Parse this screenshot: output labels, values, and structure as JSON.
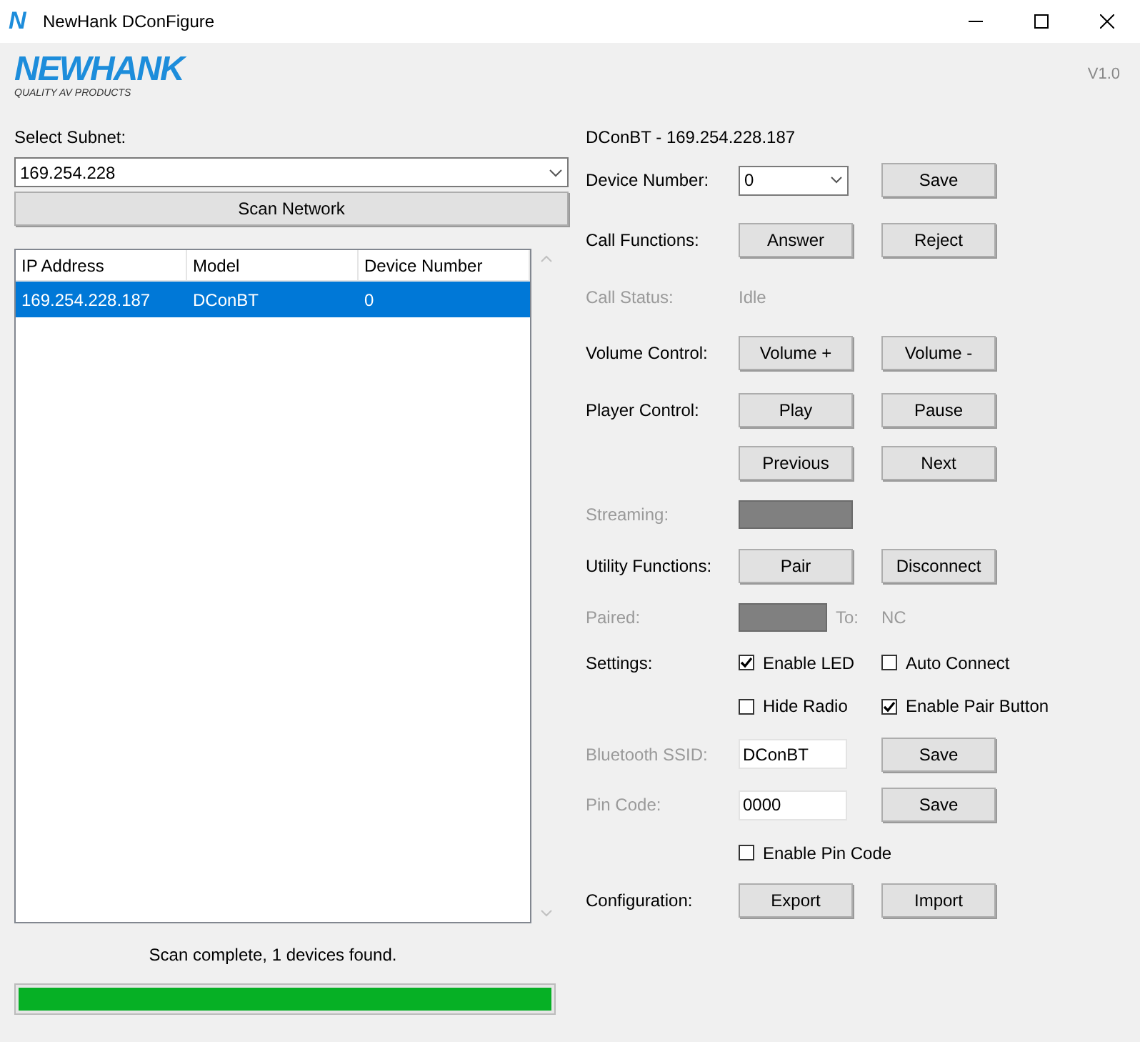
{
  "window": {
    "title": "NewHank DConFigure",
    "app_letter": "N"
  },
  "logo": {
    "name": "NEWHANK",
    "tagline": "QUALITY AV PRODUCTS"
  },
  "version": "V1.0",
  "subnet": {
    "label": "Select Subnet:",
    "value": "169.254.228"
  },
  "scan_button": "Scan Network",
  "table": {
    "columns": [
      "IP Address",
      "Model",
      "Device Number"
    ],
    "rows": [
      {
        "cells": [
          "169.254.228.187",
          "DConBT",
          "0"
        ],
        "selected": true
      }
    ]
  },
  "status_text": "Scan complete, 1 devices found.",
  "progress": {
    "level": 1
  },
  "device_panel": {
    "title": "DConBT - 169.254.228.187",
    "rows": [
      {
        "label": "Device Number:",
        "disabled": false,
        "primary": [
          {
            "kind": "select",
            "value": "0"
          }
        ],
        "secondary": [
          {
            "kind": "button",
            "label": "Save"
          }
        ]
      },
      {
        "label": "Call Functions:",
        "disabled": false,
        "primary": [
          {
            "kind": "button",
            "label": "Answer"
          }
        ],
        "secondary": [
          {
            "kind": "button",
            "label": "Reject"
          }
        ]
      },
      {
        "label": "Call Status:",
        "disabled": true,
        "primary": [
          {
            "kind": "text",
            "text": "Idle"
          }
        ],
        "secondary": []
      },
      {
        "label": "Volume Control:",
        "disabled": false,
        "primary": [
          {
            "kind": "button",
            "label": "Volume +"
          }
        ],
        "secondary": [
          {
            "kind": "button",
            "label": "Volume -"
          }
        ]
      },
      {
        "label": "Player Control:",
        "disabled": false,
        "primary": [
          {
            "kind": "button",
            "label": "Play"
          }
        ],
        "secondary": [
          {
            "kind": "button",
            "label": "Pause"
          }
        ]
      },
      {
        "primary": [
          {
            "kind": "button",
            "label": "Previous"
          }
        ],
        "secondary": [
          {
            "kind": "button",
            "label": "Next"
          }
        ]
      },
      {
        "label": "Streaming:",
        "disabled": true,
        "primary": [
          {
            "kind": "indicator",
            "on": false
          }
        ],
        "secondary": []
      },
      {
        "label": "Utility Functions:",
        "disabled": false,
        "primary": [
          {
            "kind": "button",
            "label": "Pair"
          }
        ],
        "secondary": [
          {
            "kind": "button",
            "label": "Disconnect"
          }
        ]
      },
      {
        "label": "Paired:",
        "disabled": true,
        "primary": [
          {
            "kind": "indicator",
            "on": false
          },
          {
            "kind": "text",
            "text": "To:"
          }
        ],
        "secondary": [
          {
            "kind": "text",
            "text": "NC"
          }
        ]
      },
      {
        "label": "Settings:",
        "disabled": false,
        "primary": [
          {
            "kind": "checkbox",
            "label": "Enable LED",
            "checked": true
          }
        ],
        "secondary": [
          {
            "kind": "checkbox",
            "label": "Auto Connect",
            "checked": false
          }
        ]
      },
      {
        "primary": [
          {
            "kind": "checkbox",
            "label": "Hide Radio",
            "checked": false
          }
        ],
        "secondary": [
          {
            "kind": "checkbox",
            "label": "Enable Pair Button",
            "checked": true
          }
        ]
      },
      {
        "label": "Bluetooth SSID:",
        "disabled": true,
        "primary": [
          {
            "kind": "input",
            "value": "DConBT"
          }
        ],
        "secondary": [
          {
            "kind": "button",
            "label": "Save"
          }
        ]
      },
      {
        "label": "Pin Code:",
        "disabled": true,
        "primary": [
          {
            "kind": "input",
            "value": "0000"
          }
        ],
        "secondary": [
          {
            "kind": "button",
            "label": "Save"
          }
        ]
      },
      {
        "primary": [
          {
            "kind": "checkbox",
            "label": "Enable Pin Code",
            "checked": false
          }
        ],
        "secondary": []
      },
      {
        "label": "Configuration:",
        "disabled": false,
        "primary": [
          {
            "kind": "button",
            "label": "Export"
          }
        ],
        "secondary": [
          {
            "kind": "button",
            "label": "Import"
          }
        ]
      }
    ]
  }
}
